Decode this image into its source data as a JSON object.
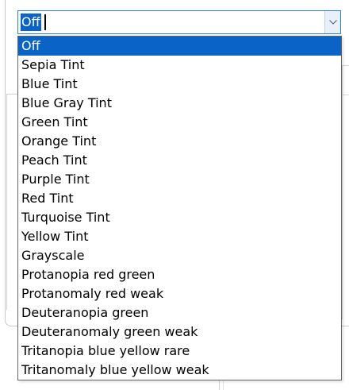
{
  "combo": {
    "value": "Off",
    "dropdown_icon": "chevron-down-icon"
  },
  "options": [
    "Off",
    "Sepia Tint",
    "Blue Tint",
    "Blue Gray Tint",
    "Green Tint",
    "Orange Tint",
    "Peach Tint",
    "Purple Tint",
    "Red Tint",
    "Turquoise Tint",
    "Yellow Tint",
    "Grayscale",
    "Protanopia red green",
    "Protanomaly red weak",
    "Deuteranopia green",
    "Deuteranomaly green weak",
    "Tritanopia blue yellow rare",
    "Tritanomaly blue yellow weak"
  ],
  "selected_index": 0,
  "colors": {
    "selection": "#0a64c8",
    "focus_border": "#2a7fd4",
    "list_border": "#646464"
  }
}
